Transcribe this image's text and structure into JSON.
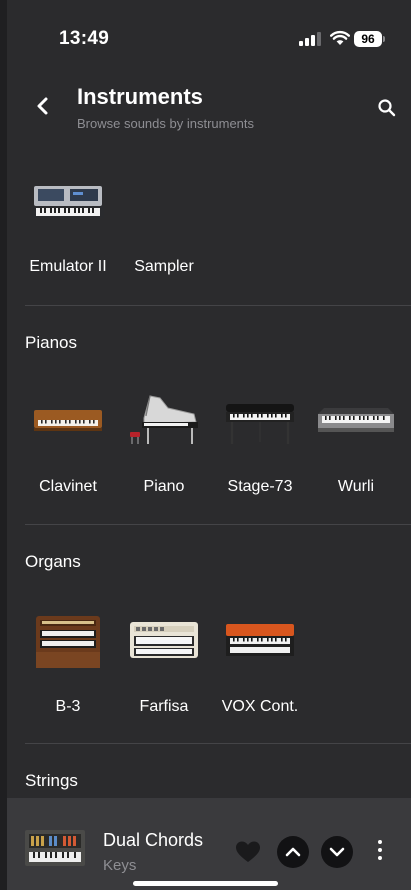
{
  "status_bar": {
    "time": "13:49",
    "battery": "96"
  },
  "header": {
    "title": "Instruments",
    "subtitle": "Browse sounds by instruments",
    "back_icon": "chevron-left-icon",
    "search_icon": "search-icon"
  },
  "top_row": [
    {
      "label": "Emulator II"
    },
    {
      "label": "Sampler"
    }
  ],
  "sections": [
    {
      "title": "Pianos",
      "items": [
        {
          "label": "Clavinet"
        },
        {
          "label": "Piano"
        },
        {
          "label": "Stage-73"
        },
        {
          "label": "Wurli"
        }
      ]
    },
    {
      "title": "Organs",
      "items": [
        {
          "label": "B-3"
        },
        {
          "label": "Farfisa"
        },
        {
          "label": "VOX Cont."
        }
      ]
    },
    {
      "title": "Strings",
      "items": []
    }
  ],
  "player": {
    "title": "Dual Chords",
    "subtitle": "Keys",
    "controls": [
      "heart-icon",
      "chevron-up-icon",
      "chevron-down-icon",
      "more-vertical-icon"
    ]
  },
  "colors": {
    "background": "#2b2b2d",
    "player_bg": "#3a3a3d",
    "muted_text": "#8e8e93"
  }
}
